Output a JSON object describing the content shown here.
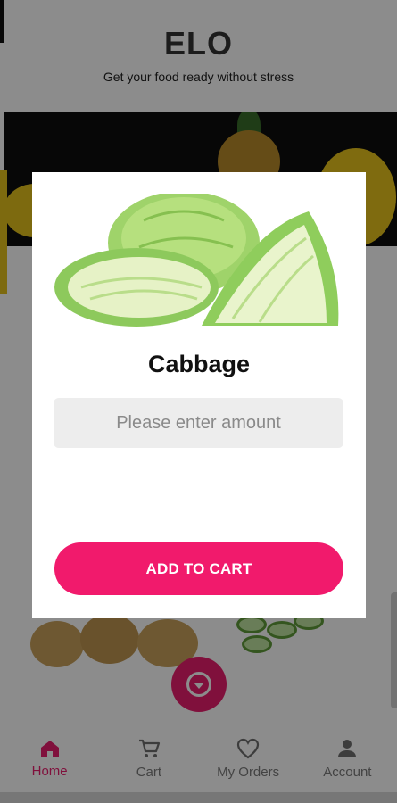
{
  "header": {
    "brand": "ELO",
    "tagline": "Get your food ready without stress"
  },
  "dialog": {
    "product_name": "Cabbage",
    "image_icon": "cabbage-image",
    "amount_input": {
      "value": "",
      "placeholder": "Please enter amount"
    },
    "add_button_label": "ADD TO CART"
  },
  "fab": {
    "icon": "chevron-down-circle-icon"
  },
  "bottom_nav": {
    "items": [
      {
        "label": "Home",
        "icon": "home-icon",
        "active": true
      },
      {
        "label": "Cart",
        "icon": "cart-icon",
        "active": false
      },
      {
        "label": "My Orders",
        "icon": "heart-icon",
        "active": false
      },
      {
        "label": "Account",
        "icon": "person-icon",
        "active": false
      }
    ]
  },
  "colors": {
    "accent": "#ea1e6e",
    "button": "#f11a6c",
    "inactive_nav": "#7a7a7a",
    "input_bg": "#ededed"
  }
}
